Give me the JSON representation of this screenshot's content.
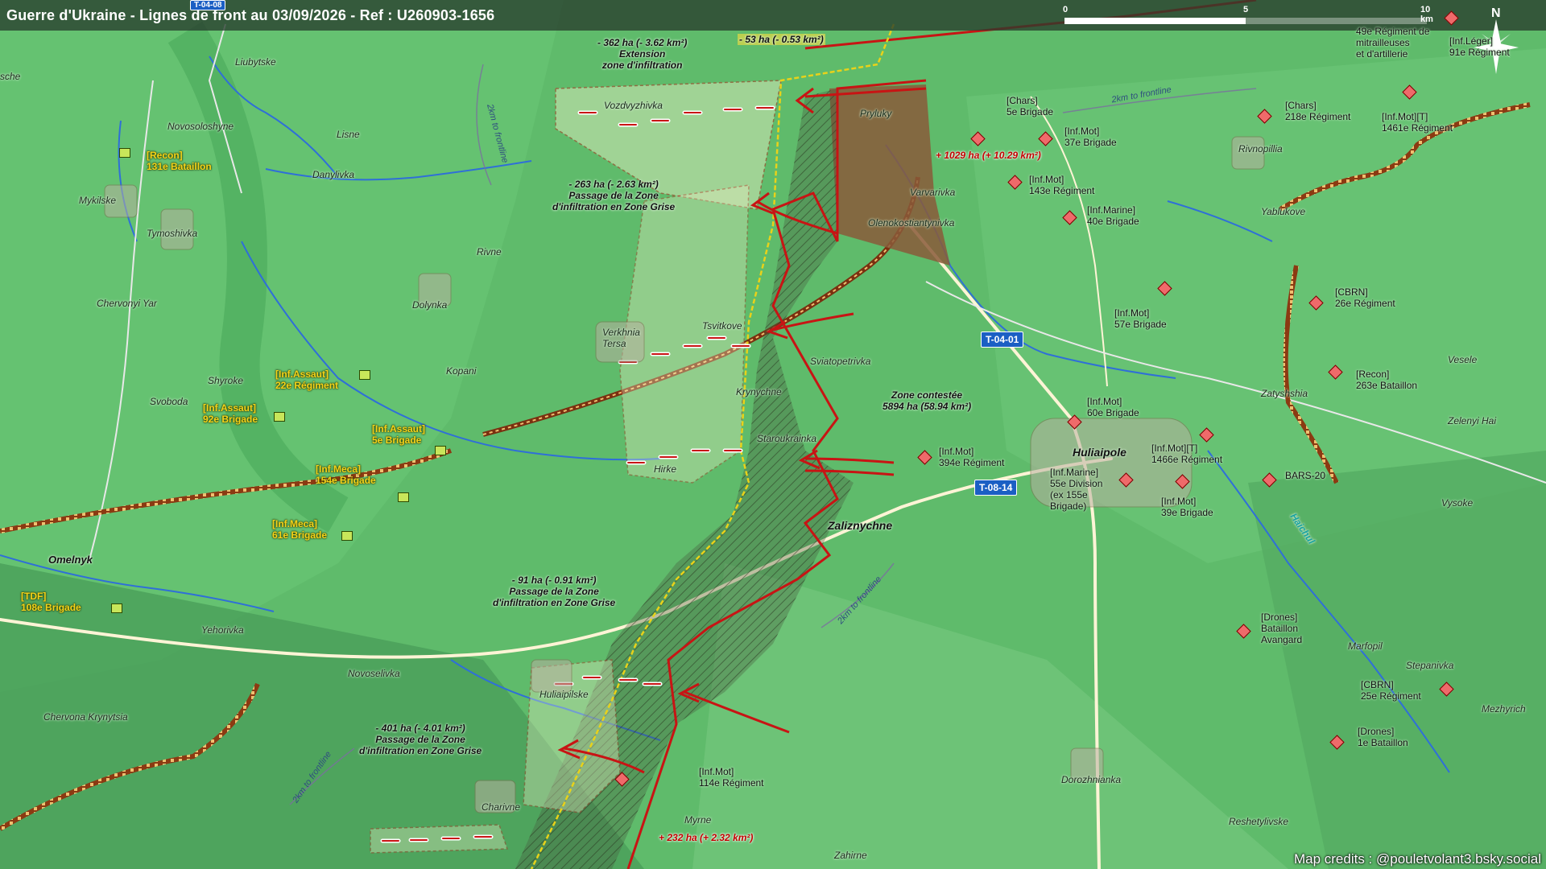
{
  "title": "Guerre d'Ukraine - Lignes de front au 03/09/2026 - Ref : U260903-1656",
  "scale": {
    "labels": [
      "0",
      "5",
      "10 km"
    ]
  },
  "compass_label": "N",
  "credits": "Map credits : @pouletvolant3.bsky.social",
  "roads": [
    "T-04-01",
    "T-08-14",
    "T-04-08"
  ],
  "frontline_labels": [
    "2km to frontline",
    "2km to frontline",
    "2km to frontline",
    "2km to frontline"
  ],
  "places": {
    "liubytske": "Liubytske",
    "novosoloshyne": "Novosoloshyne",
    "lisne": "Lisne",
    "danylivka": "Danylivka",
    "mykilske": "Mykilske",
    "tymoshivka": "Tymoshivka",
    "chervonyi_yar": "Chervonyi Yar",
    "rivne": "Rivne",
    "dolynka": "Dolynka",
    "shyroke": "Shyroke",
    "svoboda": "Svoboda",
    "kopani": "Kopani",
    "vozdvyzhivka": "Vozdvyzhivka",
    "verkhnia_tersa": "Verkhnia\nTersa",
    "tsvitkove": "Tsvitkove",
    "krynychne": "Krynychne",
    "staroukrainka": "Staroukrainka",
    "hirke": "Hirke",
    "zaliznychne": "Zaliznychne",
    "sviatopetrivka": "Sviatopetrivka",
    "pryluky": "Pryluky",
    "varvarivka": "Varvarivka",
    "olenokostiantynivka": "Olenokostiantynivka",
    "huliaipole": "Huliaipole",
    "rivnopillia": "Rivnopillia",
    "yablukove": "Yablukove",
    "veselе": "Vesele",
    "zatyshshia": "Zatyshshia",
    "zelenyi_hai": "Zelenyi Hai",
    "vysoke": "Vysoke",
    "marfopil": "Marfopil",
    "stepanivka": "Stepanivka",
    "mezhyrich": "Mezhyrich",
    "dorozhnianka": "Dorozhnianka",
    "reshetylivske": "Reshetylivske",
    "zahirne": "Zahirne",
    "myrne": "Myrne",
    "charivne": "Charivne",
    "huliaipilske": "Huliaipilske",
    "novoselivka": "Novoselivka",
    "yehorivka": "Yehorivka",
    "chervona_krynytsia": "Chervona Krynytsia",
    "omelnyk": "Omelnyk",
    "sche": "sche",
    "haichul": "Haichul"
  },
  "units_ua": {
    "recon131": "[Recon]\n131e Bataillon",
    "assault22": "[Inf.Assaut]\n22e Régiment",
    "assault92": "[Inf.Assaut]\n92e Brigade",
    "assault5": "[Inf.Assaut]\n5e Brigade",
    "meca154": "[Inf.Meca]\n154e Brigade",
    "meca61": "[Inf.Meca]\n61e Brigade",
    "tdf108": "[TDF]\n108e Brigade"
  },
  "units_ru": {
    "chars5": "[Chars]\n5e Brigade",
    "mot37": "[Inf.Mot]\n37e Brigade",
    "mot143": "[Inf.Mot]\n143e Régiment",
    "marine40": "[Inf.Marine]\n40e Brigade",
    "chars218": "[Chars]\n218e Régiment",
    "mot1461": "[Inf.Mot][T]\n1461e Régiment",
    "mitr49": "49e Régiment de\nmitrailleuses\net d'artillerie",
    "leger91": "[Inf.Léger]\n91e Régiment",
    "cbrn26": "[CBRN]\n26e Régiment",
    "mot57": "[Inf.Mot]\n57e Brigade",
    "recon263": "[Recon]\n263e Bataillon",
    "mot60": "[Inf.Mot]\n60e Brigade",
    "mot394": "[Inf.Mot]\n394e Régiment",
    "mot1466": "[Inf.Mot][T]\n1466e Régiment",
    "bars20": "BARS-20",
    "marine55": "[Inf.Marine]\n55e Division\n(ex 155e\nBrigade)",
    "mot39": "[Inf.Mot]\n39e Brigade",
    "drones_avangard": "[Drones]\nBataillon\nAvangard",
    "cbrn25": "[CBRN]\n25e Régiment",
    "drones1": "[Drones]\n1e Bataillon",
    "mot114": "[Inf.Mot]\n114e Régiment"
  },
  "annotations": {
    "ext362": "- 362 ha (- 3.62 km²)\nExtension\nzone d'infiltration",
    "a53": "- 53 ha (- 0.53 km²)",
    "plus1029": "+ 1029 ha (+ 10.29 km²)",
    "a263": "- 263 ha (- 2.63 km²)\nPassage de la Zone\nd'infiltration en Zone Grise",
    "contested": "Zone contestée\n5894 ha (58.94 km²)",
    "a91": "- 91 ha (- 0.91 km²)\nPassage de la Zone\nd'infiltration en Zone Grise",
    "a401": "- 401 ha (- 4.01 km²)\nPassage de la Zone\nd'infiltration en Zone Grise",
    "plus232": "+ 232 ha (+ 2.32 km²)"
  },
  "colors": {
    "terrain": "#5cb86a",
    "ru_controlled": "#8a5a3a",
    "front_line": "#c81414",
    "infiltration": "#f0f0c8",
    "road_badge": "#1b5fc4",
    "ua_label": "#f4d21a"
  }
}
